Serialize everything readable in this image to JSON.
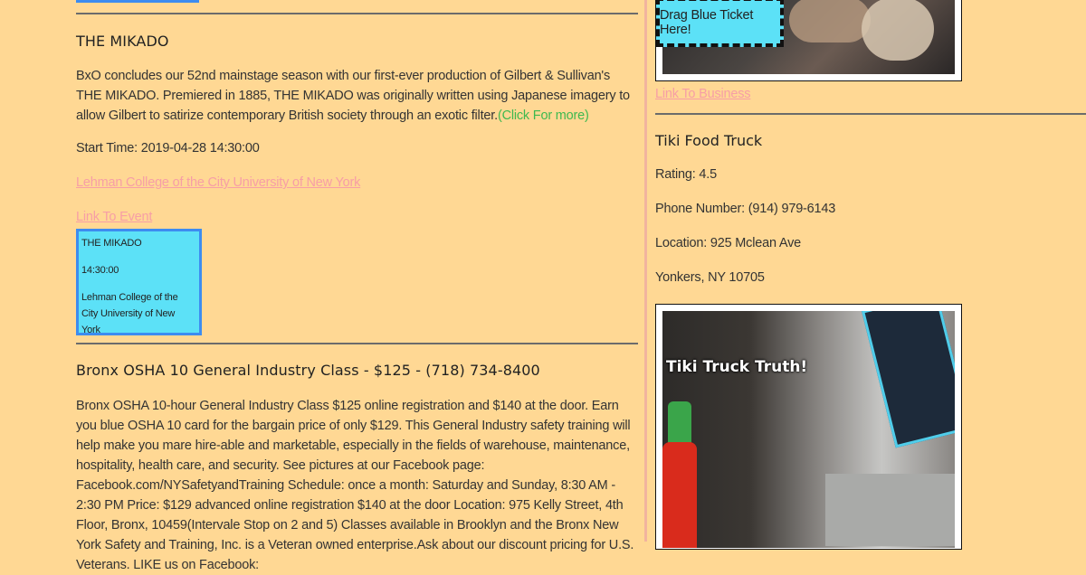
{
  "events": [
    {
      "title": "THE MIKADO",
      "description": "BxO concludes our 52nd mainstage season with our first-ever production of Gilbert & Sullivan's THE MIKADO. Premiered in 1885, THE MIKADO was originally written using Japanese imagery to allow Gilbert to satirize contemporary British society through an exotic filter.",
      "more_link": "(Click For more)",
      "start_time": "Start Time: 2019-04-28 14:30:00",
      "venue_link": "Lehman College of the City University of New York",
      "event_link": "Link To Event",
      "ticket": {
        "title": "THE MIKADO",
        "time": "14:30:00",
        "venue": "Lehman College of the City University of New York"
      }
    },
    {
      "title": "Bronx OSHA 10 General Industry Class - $125 - (718) 734-8400",
      "description": "Bronx OSHA 10-hour General Industry Class $125 online registration and $140 at the door. Earn you blue OSHA 10 card for the bargain price of only $129. This General Industry safety training will help make you mare hire-able and marketable, especially in the fields of warehouse, maintenance, hospitality, health care, and security. See pictures at our Facebook page: Facebook.com/NYSafetyandTraining Schedule: once a month: Saturday and Sunday, 8:30 AM - 2:30 PM Price: $129 advanced online registration $140 at the door Location: 975 Kelly Street, 4th Floor, Bronx, 10459(Intervale Stop on 2 and 5) Classes available in Brooklyn and the Bronx New York Safety and Training, Inc. is a Veteran owned enterprise.Ask about our discount pricing for U.S. Veterans. LIKE us on Facebook:"
    }
  ],
  "drop_zone_label": "Drag Blue Ticket Here!",
  "business_link": "Link To Business",
  "business": {
    "name": "Tiki Food Truck",
    "rating": "Rating: 4.5",
    "phone": "Phone Number: (914) 979-6143",
    "location": "Location: 925 Mclean Ave",
    "city": "Yonkers, NY 10705",
    "photo_caption": "Tiki Truck Truth!"
  },
  "colors": {
    "background": "#ffd894",
    "ticket": "#5ce1f7",
    "ticket_border": "#3d8cf0",
    "link_pink": "#f79ea6",
    "link_green": "#3eb94f"
  }
}
